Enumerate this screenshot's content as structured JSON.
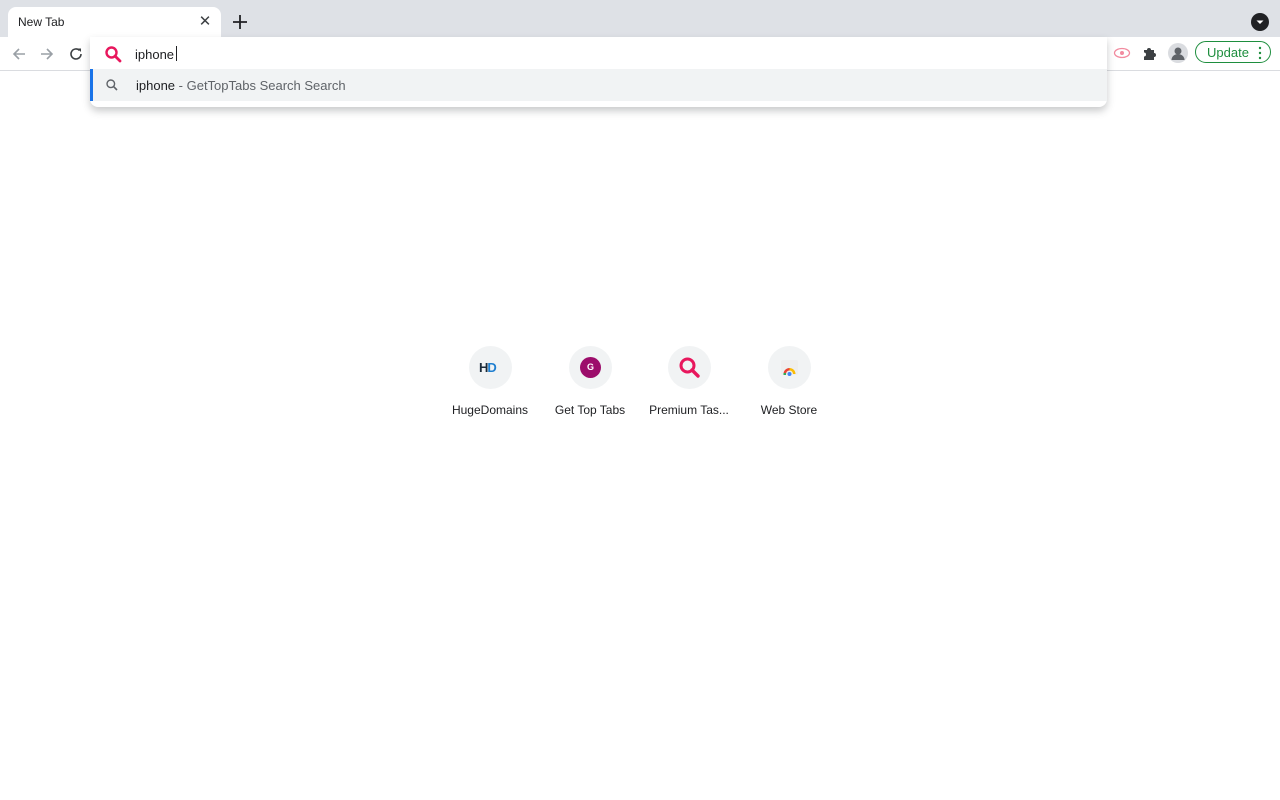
{
  "tab": {
    "title": "New Tab",
    "close": "✕"
  },
  "omnibox": {
    "value": "iphone"
  },
  "suggestion": {
    "query": "iphone",
    "description": " - GetTopTabs Search Search"
  },
  "toolbar": {
    "update_label": "Update"
  },
  "shortcuts": [
    {
      "label": "HugeDomains",
      "logo_text_h": "H",
      "logo_text_d": "D"
    },
    {
      "label": "Get Top Tabs",
      "logo_text": "G"
    },
    {
      "label": "Premium Tas..."
    },
    {
      "label": "Web Store"
    }
  ],
  "colors": {
    "accent": "#1a73e8",
    "update_green": "#1e8e3e",
    "search_red": "#e8175d"
  }
}
